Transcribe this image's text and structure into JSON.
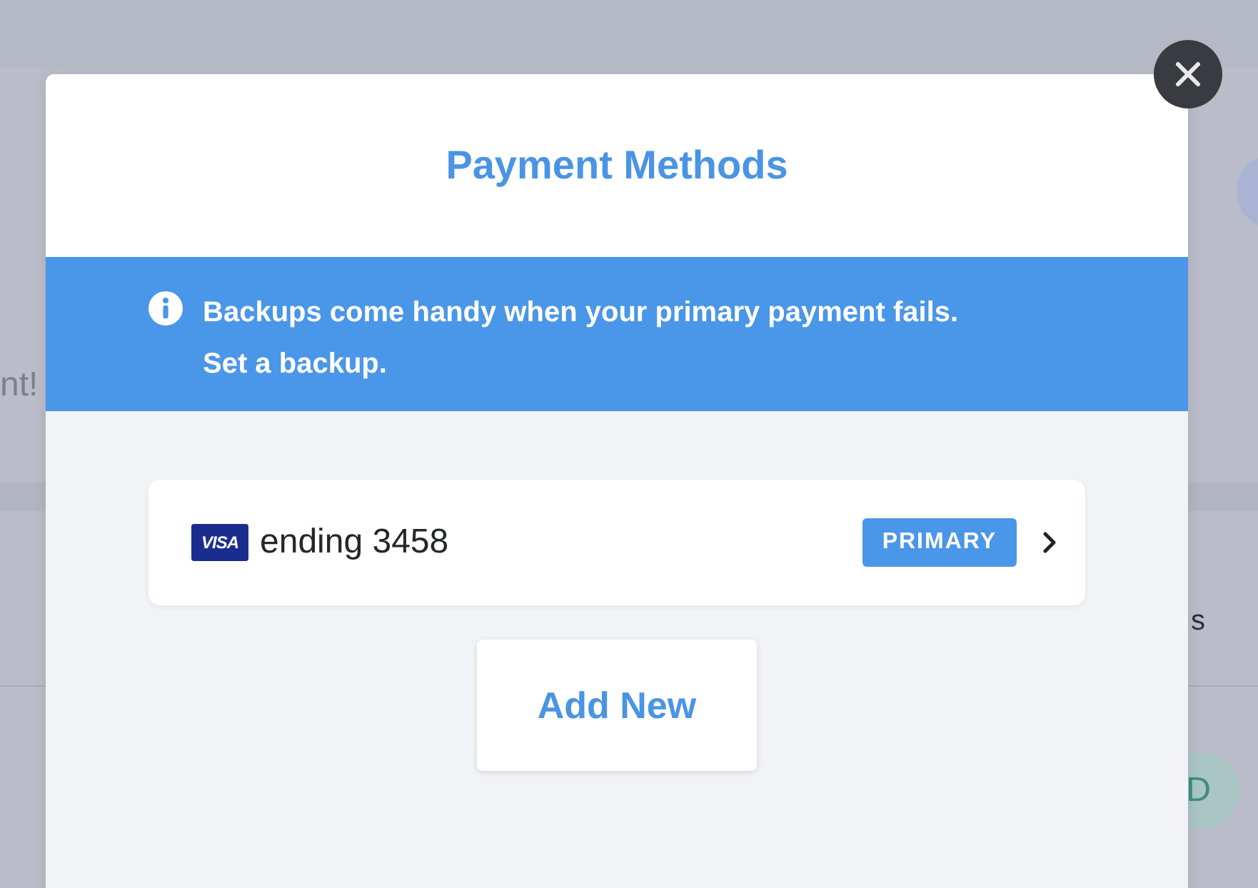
{
  "background": {
    "texts": [
      {
        "kind": "greeting",
        "text": "nt!"
      },
      {
        "kind": "label",
        "text": "s"
      },
      {
        "kind": "pill",
        "text": "D"
      }
    ]
  },
  "modal": {
    "title": "Payment Methods",
    "notice": "Backups come handy when your primary payment fails. Set a backup.",
    "cards": [
      {
        "brand": "VISA",
        "label": "ending 3458",
        "badge": "PRIMARY"
      }
    ],
    "add_button": "Add New"
  }
}
